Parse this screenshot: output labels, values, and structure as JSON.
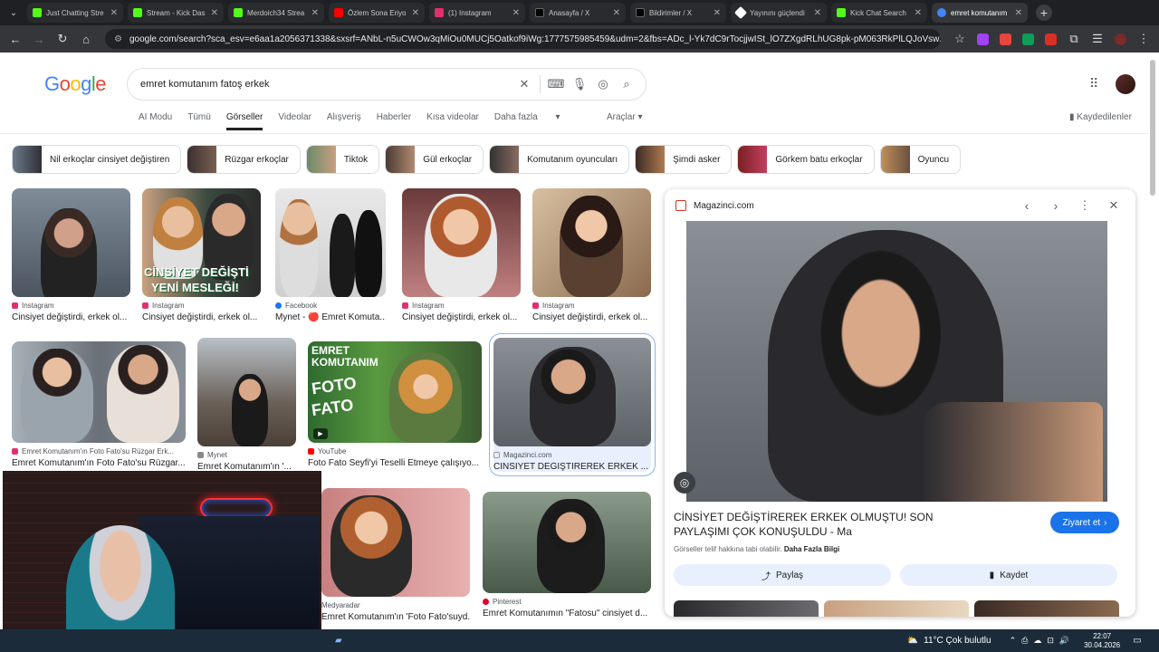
{
  "tabs": [
    {
      "title": "Just Chatting Stre",
      "color": "#53fc18"
    },
    {
      "title": "Stream - Kick Das",
      "color": "#53fc18"
    },
    {
      "title": "Merdoich34 Strea",
      "color": "#53fc18"
    },
    {
      "title": "Özlem Sona Eriyo",
      "color": "#ff0000"
    },
    {
      "title": "(1) Instagram",
      "color": "#e1306c"
    },
    {
      "title": "Anasayfa / X",
      "color": "#000000"
    },
    {
      "title": "Bildirimler / X",
      "color": "#000000"
    },
    {
      "title": "Yayınını güçlendi",
      "color": "#ffffff"
    },
    {
      "title": "Kick Chat Search",
      "color": "#53fc18"
    },
    {
      "title": "emret komutanım",
      "color": "#4285f4"
    }
  ],
  "browser": {
    "url": "google.com/search?sca_esv=e6aa1a2056371338&sxsrf=ANbL-n5uCWOw3qMiOu0MUCj5Oatkof9iWg:1777575985459&udm=2&fbs=ADc_l-Yk7dC9rTocjjwISt_lO7ZXgdRLhUG8pk-pM063RkPlLQJoVswXu7XoIdd5UH6fMlp..."
  },
  "google": {
    "logo": "Google",
    "query": "emret komutanım fatoş erkek",
    "filters": [
      "AI Modu",
      "Tümü",
      "Görseller",
      "Videolar",
      "Alışveriş",
      "Haberler",
      "Kısa videolar",
      "Daha fazla"
    ],
    "selected_filter": "Görseller",
    "tools_label": "Araçlar",
    "saved_label": "Kaydedilenler"
  },
  "chips": [
    "Nil erkoçlar cinsiyet değiştiren",
    "Rüzgar erkoçlar",
    "Tiktok",
    "Gül erkoçlar",
    "Komutanım oyuncuları",
    "Şimdi asker",
    "Görkem batu erkoçlar",
    "Oyuncu"
  ],
  "results": [
    {
      "source": "Instagram",
      "title": "Cinsiyet değiştirdi, erkek ol..."
    },
    {
      "source": "Instagram",
      "title": "Cinsiyet değiştirdi, erkek ol...",
      "overlay": [
        "CİNSİYET DEĞİŞTİ",
        "YENİ MESLEĞİ!"
      ]
    },
    {
      "source": "Facebook",
      "title": "Mynet - 🔴 Emret Komuta..."
    },
    {
      "source": "Instagram",
      "title": "Cinsiyet değiştirdi, erkek ol..."
    },
    {
      "source": "Instagram",
      "title": "Cinsiyet değiştirdi, erkek ol..."
    },
    {
      "source": "Emret Komutanım'ın Foto Fato'su Rüzgar Erk...",
      "title": "Emret Komutanım'ın Foto Fato'su Rüzgar..."
    },
    {
      "source": "Mynet",
      "title": "Emret Komutanım'ın '..."
    },
    {
      "source": "YouTube",
      "title": "Foto Fato Seyfi'yi Teselli Etmeye çalışıyo...",
      "overlay": [
        "EMRET",
        "KOMUTANIM",
        "FOTO",
        "FATO"
      ]
    },
    {
      "source": "Magazinci.com",
      "title": "CİNSİYET DEĞİŞTİREREK ERKEK ..."
    },
    {
      "source": "Medyaradar",
      "title": "Emret Komutanım'ın 'Foto Fato'suyd..."
    },
    {
      "source": "Pinterest",
      "title": "Emret Komutanımın \"Fatosu\" cinsiyet d..."
    }
  ],
  "panel": {
    "source": "Magazinci.com",
    "title": "CİNSİYET DEĞİŞTİREREK ERKEK OLMUŞTU! SON PAYLAŞIMI ÇOK KONUŞULDU - Ma",
    "visit_label": "Ziyaret et",
    "copyright": "Görseller telif hakkına tabi olabilir.",
    "more_info": "Daha Fazla Bilgi",
    "share_label": "Paylaş",
    "save_label": "Kaydet"
  },
  "taskbar": {
    "weather": "11°C  Çok bulutlu",
    "time": "22:07",
    "date": "30.04.2026"
  }
}
